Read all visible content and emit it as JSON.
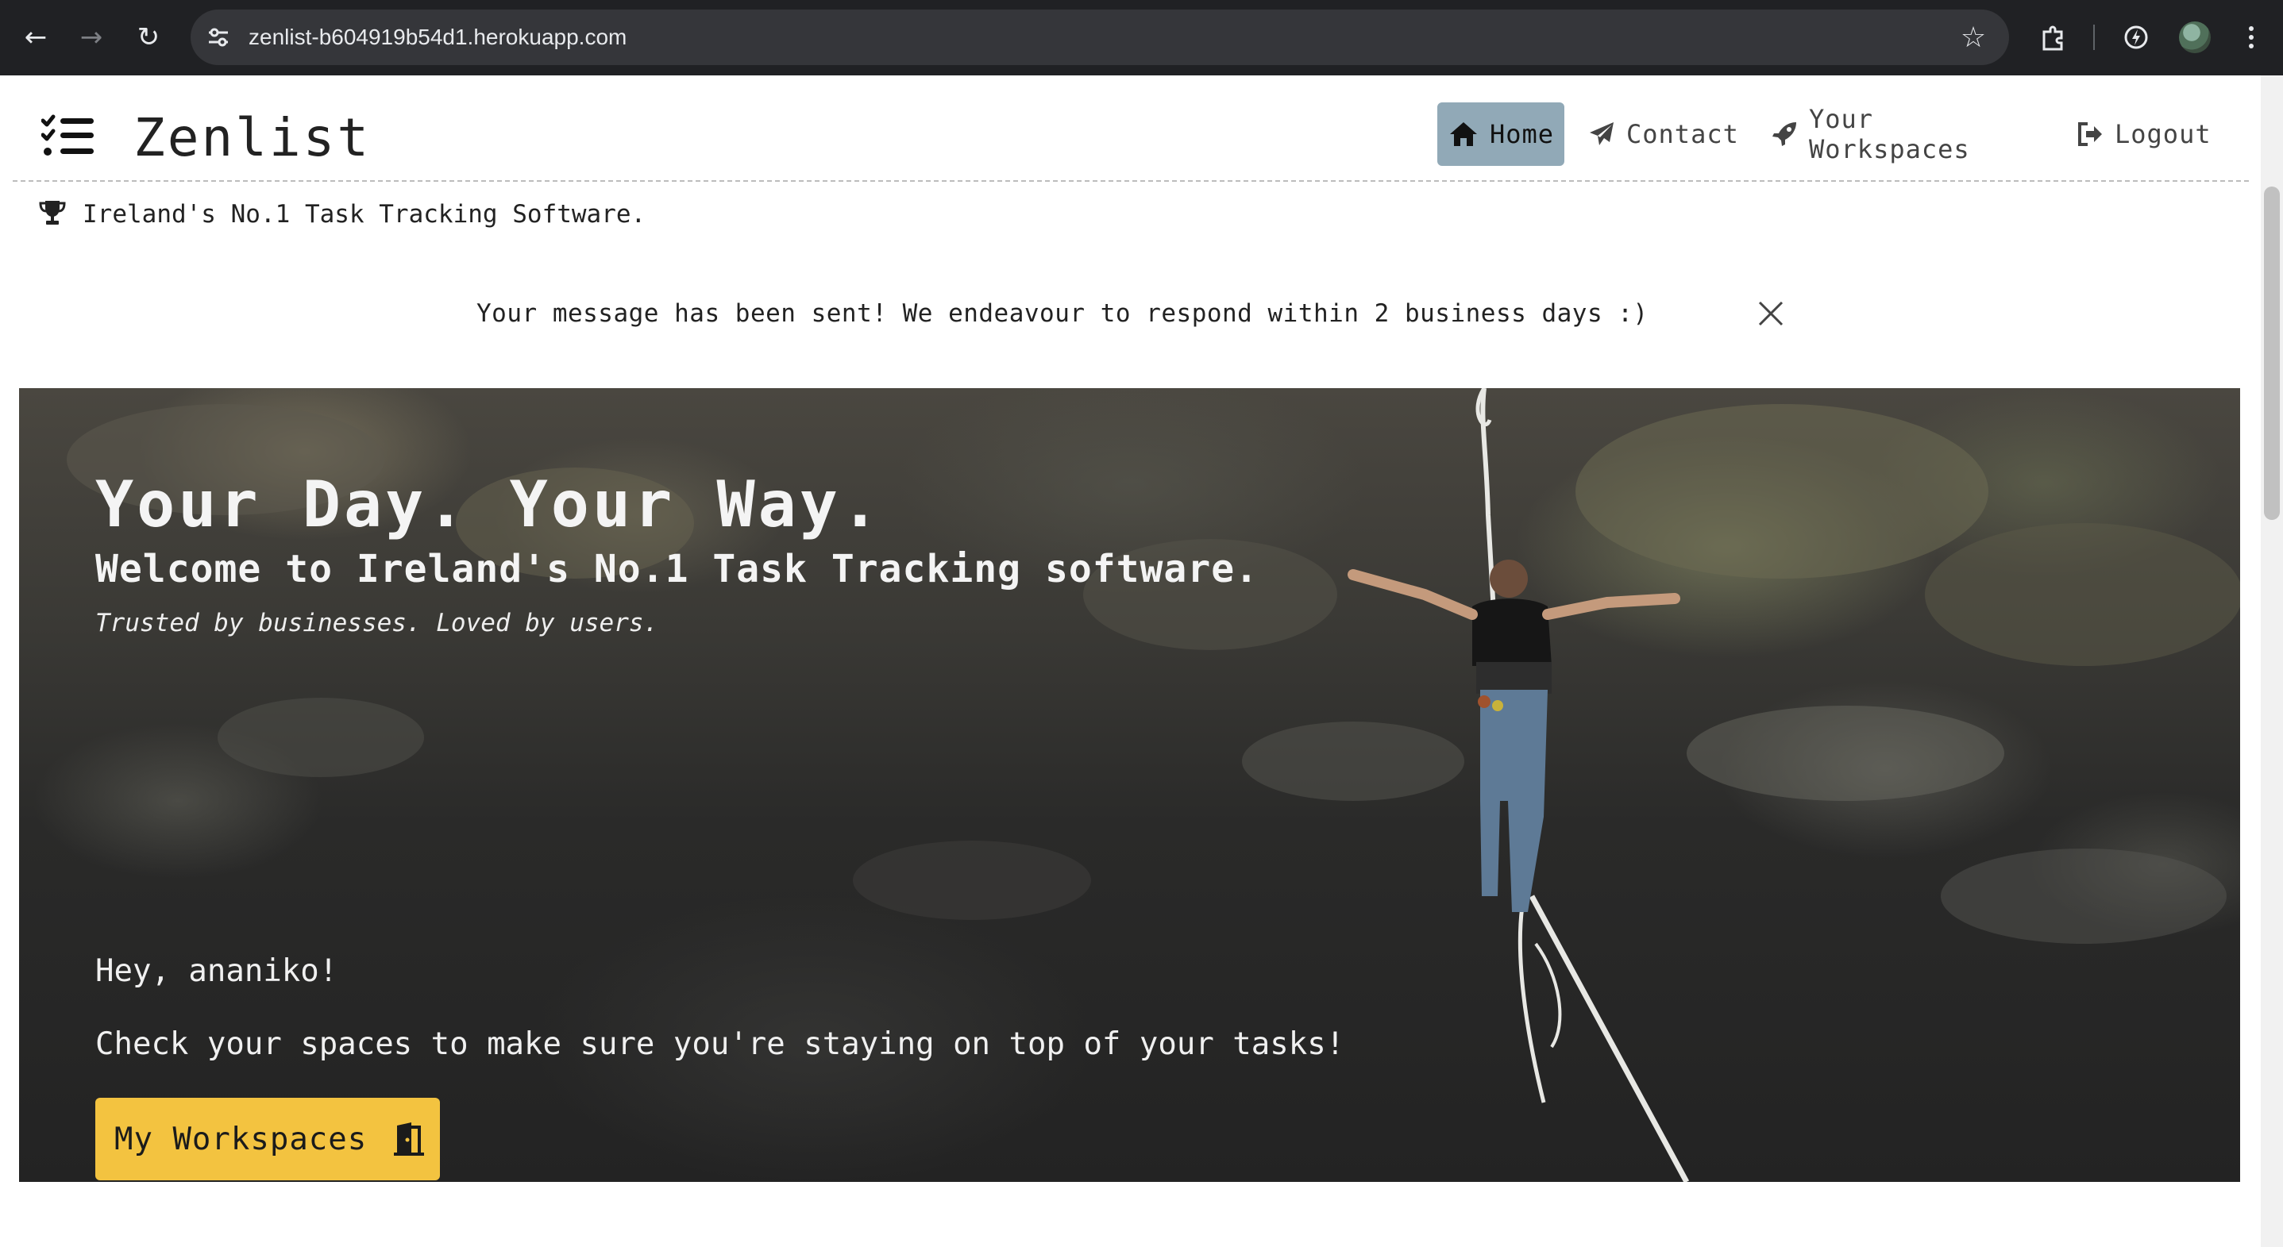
{
  "browser": {
    "url": "zenlist-b604919b54d1.herokuapp.com",
    "icons": [
      "back-icon",
      "forward-icon",
      "reload-icon",
      "site-info-icon",
      "star-icon",
      "extensions-icon",
      "performance-icon",
      "avatar",
      "menu-icon"
    ]
  },
  "header": {
    "brand": "Zenlist",
    "nav": {
      "home": "Home",
      "contact": "Contact",
      "workspaces": "Your Workspaces",
      "logout": "Logout"
    },
    "tagline": "Ireland's No.1 Task Tracking Software."
  },
  "alert": {
    "message": "Your message has been sent! We endeavour to respond within 2 business days :)"
  },
  "hero": {
    "title": "Your Day. Your Way.",
    "subtitle": "Welcome to Ireland's No.1 Task Tracking software.",
    "tagline": "Trusted by businesses. Loved by users.",
    "greeting": "Hey, ananiko!",
    "message": "Check your spaces to make sure you're staying on top of your tasks!",
    "button_label": "My Workspaces"
  },
  "colors": {
    "nav_active_bg": "#91a9b7",
    "button_bg": "#f3c340",
    "chrome_bg": "#202124"
  }
}
